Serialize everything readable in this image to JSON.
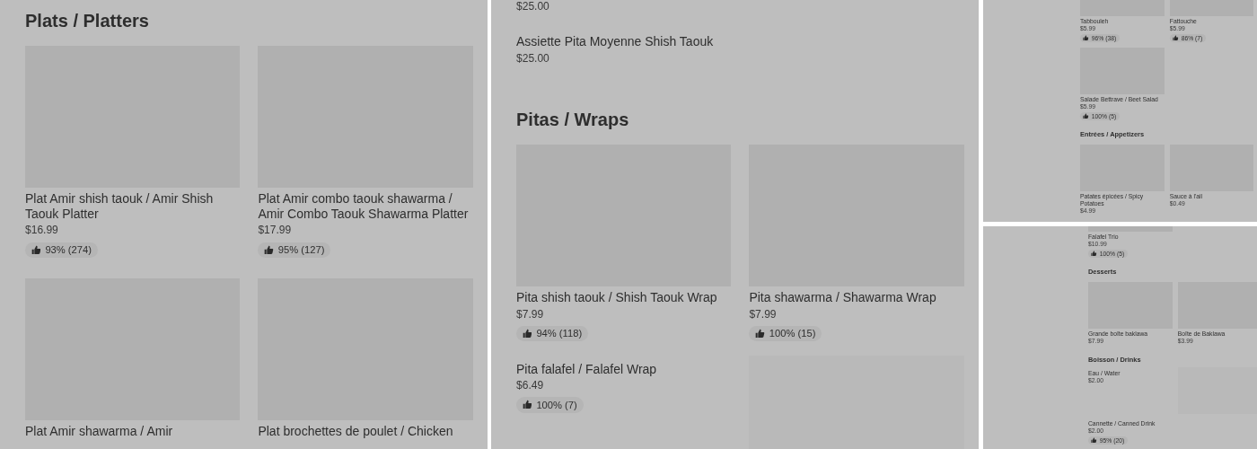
{
  "panels": [
    {
      "sections": [
        {
          "heading": "Plats / Platters",
          "items": [
            {
              "kind": "tile",
              "name": "Plat Amir shish taouk / Amir Shish Taouk Platter",
              "price": "$16.99",
              "rating": "93% (274)"
            },
            {
              "kind": "tile",
              "name": "Plat Amir combo taouk shawarma / Amir Combo Taouk Shawarma Platter",
              "price": "$17.99",
              "rating": "95% (127)"
            },
            {
              "kind": "tile",
              "name": "Plat Amir shawarma / Amir"
            },
            {
              "kind": "tile",
              "name": "Plat brochettes de poulet / Chicken"
            }
          ]
        }
      ]
    },
    {
      "sections": [
        {
          "items": [
            {
              "kind": "row",
              "price": "$25.00",
              "image": false
            },
            {
              "kind": "row",
              "name": "Assiette Pita Moyenne Shish Taouk",
              "price": "$25.00",
              "image": false
            }
          ]
        },
        {
          "heading": "Pitas / Wraps",
          "items": [
            {
              "kind": "tile",
              "name": "Pita shish taouk / Shish Taouk Wrap",
              "price": "$7.99",
              "rating": "94% (118)"
            },
            {
              "kind": "tile",
              "name": "Pita shawarma / Shawarma Wrap",
              "price": "$7.99",
              "rating": "100% (15)"
            },
            {
              "kind": "row",
              "name": "Pita falafel / Falafel Wrap",
              "price": "$6.49",
              "rating": "100% (7)",
              "image": true
            }
          ]
        }
      ]
    },
    {
      "sections": [
        {
          "items": [
            {
              "kind": "tile",
              "name": "Tabbouleh",
              "price": "$5.99",
              "rating": "96% (38)"
            },
            {
              "kind": "tile",
              "name": "Fattouche",
              "price": "$5.99",
              "rating": "86% (7)"
            },
            {
              "kind": "tile",
              "name": "Salade Bettrave / Beet Salad",
              "price": "$5.99",
              "rating": "100% (5)"
            }
          ]
        },
        {
          "heading": "Entrées / Appetizers",
          "items": [
            {
              "kind": "tile",
              "name": "Patates épicées / Spicy Potatoes",
              "price": "$4.99"
            },
            {
              "kind": "tile",
              "name": "Sauce à l'ail",
              "price": "$0.49"
            }
          ]
        }
      ]
    },
    {
      "sections": [
        {
          "items": [
            {
              "kind": "tile",
              "name": "Falafel Trio",
              "price": "$10.99",
              "rating": "100% (5)"
            }
          ]
        },
        {
          "heading": "Desserts",
          "items": [
            {
              "kind": "tile",
              "name": "Grande boîte baklawa",
              "price": "$7.99"
            },
            {
              "kind": "tile",
              "name": "Boîte de Baklawa",
              "price": "$3.99"
            }
          ]
        },
        {
          "heading": "Boisson / Drinks",
          "items": [
            {
              "kind": "row",
              "name": "Eau / Water",
              "price": "$2.00",
              "image": true
            },
            {
              "kind": "row",
              "name": "Cannette / Canned Drink",
              "price": "$2.00",
              "rating": "95% (20)",
              "image": false
            }
          ]
        }
      ]
    }
  ]
}
